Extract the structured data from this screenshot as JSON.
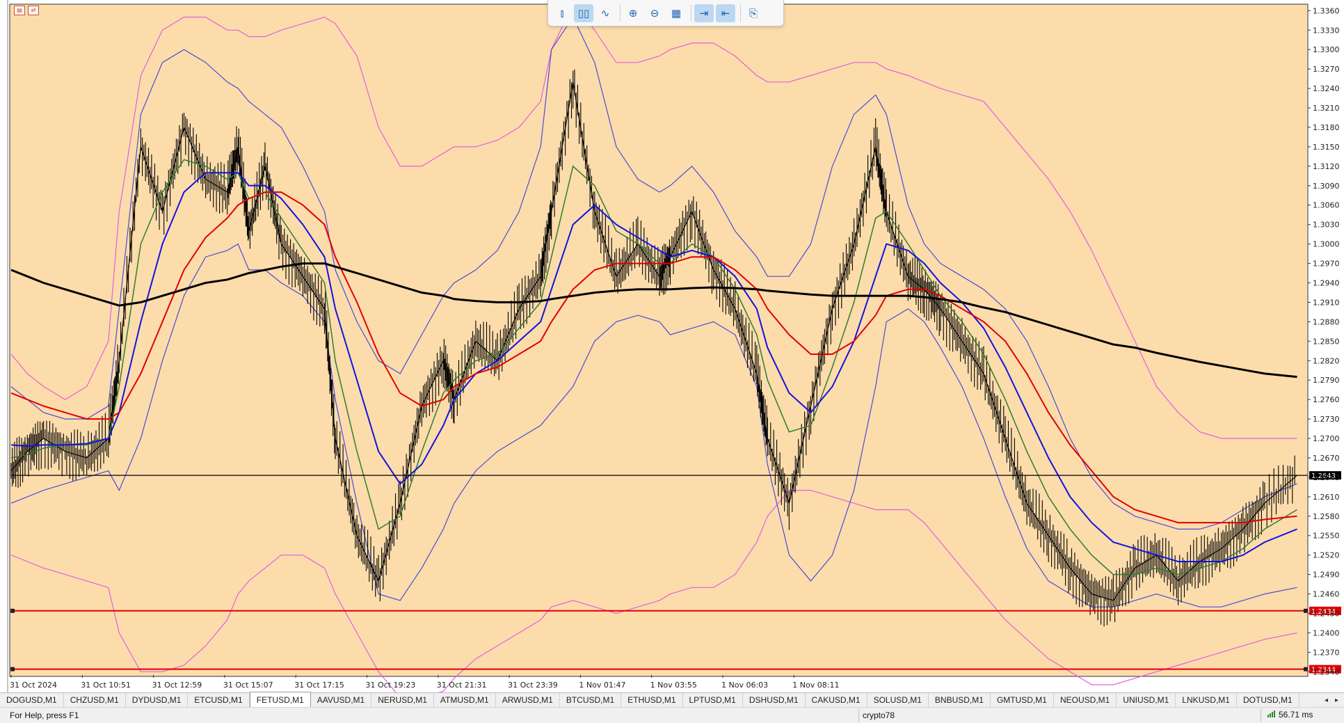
{
  "toolbar": {
    "buttons": [
      {
        "name": "bar-chart-icon",
        "glyph": "⫾",
        "active": false
      },
      {
        "name": "candlestick-chart-icon",
        "glyph": "▯▯",
        "active": true
      },
      {
        "name": "line-chart-icon",
        "glyph": "∿",
        "active": false
      },
      {
        "name": "zoom-in-icon",
        "glyph": "⊕",
        "active": false
      },
      {
        "name": "zoom-out-icon",
        "glyph": "⊖",
        "active": false
      },
      {
        "name": "grid-icon",
        "glyph": "▦",
        "active": false
      },
      {
        "name": "auto-scroll-icon",
        "glyph": "⇥",
        "active": true
      },
      {
        "name": "chart-shift-icon",
        "glyph": "⇤",
        "active": true
      },
      {
        "name": "screenshot-icon",
        "glyph": "⎘",
        "active": false
      }
    ]
  },
  "chart": {
    "background": "#fcdcab",
    "symbol_tab_active": "FETUSD,M1",
    "current_price": "1.2643",
    "levels": [
      {
        "value": "1.2434",
        "color": "#e00000"
      },
      {
        "value": "1.2344",
        "color": "#e00000"
      }
    ],
    "colors": {
      "candles": "#000000",
      "ma_fast": "#2f7d2f",
      "ma_mid": "#1212e0",
      "ma_slow": "#e00000",
      "ma_long": "#000000",
      "bb_inner": "#4a4ad8",
      "bb_outer": "#e060e0"
    }
  },
  "chart_data": {
    "type": "line",
    "title": "",
    "symbol": "FETUSD,M1",
    "y_ticks": [
      "1.3360",
      "1.3330",
      "1.3300",
      "1.3270",
      "1.3240",
      "1.3210",
      "1.3180",
      "1.3150",
      "1.3120",
      "1.3090",
      "1.3060",
      "1.3030",
      "1.3000",
      "1.2970",
      "1.2940",
      "1.2910",
      "1.2880",
      "1.2850",
      "1.2820",
      "1.2790",
      "1.2760",
      "1.2730",
      "1.2700",
      "1.2670",
      "1.2640",
      "1.2610",
      "1.2580",
      "1.2550",
      "1.2520",
      "1.2490",
      "1.2460",
      "1.2430",
      "1.2400",
      "1.2370",
      "1.2340"
    ],
    "x_ticks": [
      "31 Oct 2024",
      "31 Oct 10:51",
      "31 Oct 12:59",
      "31 Oct 15:07",
      "31 Oct 17:15",
      "31 Oct 19:23",
      "31 Oct 21:31",
      "31 Oct 23:39",
      "1 Nov 01:47",
      "1 Nov 03:55",
      "1 Nov 06:03",
      "1 Nov 08:11"
    ],
    "ylim": [
      1.2335,
      1.337
    ],
    "price_series": {
      "name": "",
      "x": [
        0,
        0.15,
        0.3,
        0.5,
        0.7,
        0.9,
        1.0,
        1.2,
        1.4,
        1.6,
        1.8,
        2.0,
        2.1,
        2.2,
        2.35,
        2.5,
        2.7,
        2.9,
        3.0,
        3.2,
        3.4,
        3.6,
        3.8,
        4.0,
        4.1,
        4.3,
        4.5,
        4.7,
        4.9,
        5.0,
        5.2,
        5.4,
        5.6,
        5.8,
        6.0,
        6.1,
        6.3,
        6.5,
        6.7,
        6.9,
        7.0,
        7.2,
        7.4,
        7.6,
        7.8,
        8.0,
        8.1,
        8.3,
        8.45,
        8.6,
        8.8,
        9.0,
        9.2,
        9.4,
        9.6,
        9.8,
        10.0,
        10.2,
        10.4,
        10.6,
        10.8,
        11.0,
        11.2,
        11.4,
        11.6,
        11.9
      ],
      "values": [
        1.265,
        1.268,
        1.27,
        1.268,
        1.267,
        1.27,
        1.282,
        1.315,
        1.305,
        1.318,
        1.31,
        1.308,
        1.315,
        1.302,
        1.312,
        1.3,
        1.295,
        1.29,
        1.27,
        1.255,
        1.248,
        1.26,
        1.275,
        1.282,
        1.276,
        1.285,
        1.282,
        1.29,
        1.295,
        1.305,
        1.325,
        1.305,
        1.295,
        1.3,
        1.295,
        1.298,
        1.305,
        1.296,
        1.29,
        1.28,
        1.27,
        1.26,
        1.275,
        1.29,
        1.3,
        1.315,
        1.305,
        1.295,
        1.293,
        1.29,
        1.285,
        1.28,
        1.27,
        1.26,
        1.255,
        1.25,
        1.246,
        1.245,
        1.25,
        1.252,
        1.248,
        1.251,
        1.253,
        1.256,
        1.26,
        1.2643
      ]
    },
    "series": [
      {
        "name": "",
        "role": "ma_fast",
        "values": [
          1.267,
          1.2675,
          1.2685,
          1.269,
          1.269,
          1.27,
          1.278,
          1.3,
          1.308,
          1.313,
          1.312,
          1.31,
          1.311,
          1.307,
          1.308,
          1.304,
          1.299,
          1.294,
          1.282,
          1.268,
          1.256,
          1.258,
          1.268,
          1.277,
          1.279,
          1.282,
          1.283,
          1.287,
          1.291,
          1.298,
          1.312,
          1.309,
          1.302,
          1.3,
          1.297,
          1.297,
          1.3,
          1.298,
          1.293,
          1.286,
          1.279,
          1.271,
          1.272,
          1.281,
          1.291,
          1.304,
          1.305,
          1.3,
          1.296,
          1.292,
          1.288,
          1.283,
          1.276,
          1.268,
          1.261,
          1.256,
          1.252,
          1.249,
          1.249,
          1.25,
          1.249,
          1.25,
          1.251,
          1.253,
          1.256,
          1.259
        ]
      },
      {
        "name": "",
        "role": "ma_mid",
        "values": [
          1.269,
          1.2688,
          1.269,
          1.269,
          1.2692,
          1.27,
          1.274,
          1.288,
          1.3,
          1.308,
          1.311,
          1.311,
          1.311,
          1.309,
          1.309,
          1.307,
          1.303,
          1.298,
          1.29,
          1.279,
          1.268,
          1.263,
          1.266,
          1.272,
          1.276,
          1.28,
          1.282,
          1.285,
          1.288,
          1.293,
          1.303,
          1.306,
          1.303,
          1.301,
          1.299,
          1.298,
          1.299,
          1.298,
          1.295,
          1.29,
          1.284,
          1.277,
          1.274,
          1.278,
          1.285,
          1.295,
          1.3,
          1.299,
          1.297,
          1.294,
          1.291,
          1.287,
          1.281,
          1.274,
          1.267,
          1.261,
          1.257,
          1.254,
          1.253,
          1.252,
          1.251,
          1.251,
          1.251,
          1.252,
          1.254,
          1.256
        ]
      },
      {
        "name": "",
        "role": "ma_slow",
        "values": [
          1.277,
          1.276,
          1.275,
          1.274,
          1.273,
          1.273,
          1.274,
          1.28,
          1.288,
          1.296,
          1.301,
          1.304,
          1.306,
          1.307,
          1.308,
          1.308,
          1.306,
          1.303,
          1.298,
          1.291,
          1.283,
          1.277,
          1.275,
          1.276,
          1.278,
          1.28,
          1.281,
          1.283,
          1.285,
          1.288,
          1.293,
          1.296,
          1.297,
          1.297,
          1.297,
          1.297,
          1.298,
          1.298,
          1.296,
          1.293,
          1.29,
          1.286,
          1.283,
          1.283,
          1.285,
          1.289,
          1.292,
          1.293,
          1.293,
          1.292,
          1.29,
          1.288,
          1.285,
          1.28,
          1.274,
          1.269,
          1.265,
          1.261,
          1.259,
          1.258,
          1.257,
          1.257,
          1.257,
          1.257,
          1.2575,
          1.258
        ]
      },
      {
        "name": "",
        "role": "ma_long",
        "values": [
          1.296,
          1.295,
          1.294,
          1.293,
          1.292,
          1.291,
          1.2905,
          1.291,
          1.292,
          1.293,
          1.294,
          1.2945,
          1.295,
          1.2955,
          1.296,
          1.2965,
          1.297,
          1.297,
          1.2965,
          1.2955,
          1.2945,
          1.2935,
          1.2925,
          1.292,
          1.2915,
          1.2912,
          1.291,
          1.291,
          1.2912,
          1.2915,
          1.292,
          1.2925,
          1.2928,
          1.293,
          1.293,
          1.293,
          1.2932,
          1.2933,
          1.2932,
          1.293,
          1.2928,
          1.2925,
          1.2922,
          1.292,
          1.292,
          1.292,
          1.292,
          1.292,
          1.2918,
          1.2915,
          1.291,
          1.2902,
          1.2895,
          1.2885,
          1.2875,
          1.2865,
          1.2855,
          1.2845,
          1.284,
          1.2832,
          1.2825,
          1.2818,
          1.2812,
          1.2806,
          1.28,
          1.2795
        ]
      },
      {
        "name": "",
        "role": "bb_inner_upper",
        "values": [
          1.278,
          1.276,
          1.274,
          1.273,
          1.273,
          1.275,
          1.29,
          1.32,
          1.328,
          1.33,
          1.328,
          1.325,
          1.324,
          1.322,
          1.32,
          1.318,
          1.312,
          1.305,
          1.296,
          1.288,
          1.282,
          1.28,
          1.286,
          1.292,
          1.294,
          1.296,
          1.299,
          1.305,
          1.315,
          1.33,
          1.335,
          1.328,
          1.315,
          1.31,
          1.308,
          1.309,
          1.312,
          1.308,
          1.302,
          1.298,
          1.295,
          1.295,
          1.3,
          1.312,
          1.32,
          1.323,
          1.32,
          1.306,
          1.3,
          1.297,
          1.295,
          1.293,
          1.29,
          1.285,
          1.278,
          1.27,
          1.264,
          1.26,
          1.258,
          1.257,
          1.256,
          1.256,
          1.257,
          1.259,
          1.261,
          1.263
        ]
      },
      {
        "name": "",
        "role": "bb_inner_lower",
        "values": [
          1.26,
          1.261,
          1.262,
          1.263,
          1.264,
          1.265,
          1.262,
          1.27,
          1.282,
          1.292,
          1.298,
          1.299,
          1.3,
          1.296,
          1.296,
          1.294,
          1.292,
          1.288,
          1.276,
          1.26,
          1.246,
          1.245,
          1.25,
          1.256,
          1.26,
          1.265,
          1.268,
          1.27,
          1.272,
          1.274,
          1.278,
          1.285,
          1.288,
          1.289,
          1.288,
          1.286,
          1.287,
          1.288,
          1.286,
          1.278,
          1.266,
          1.252,
          1.248,
          1.252,
          1.262,
          1.278,
          1.288,
          1.29,
          1.288,
          1.284,
          1.278,
          1.27,
          1.261,
          1.253,
          1.248,
          1.246,
          1.244,
          1.244,
          1.245,
          1.246,
          1.245,
          1.244,
          1.244,
          1.245,
          1.246,
          1.247
        ]
      },
      {
        "name": "",
        "role": "bb_outer_upper",
        "values": [
          1.283,
          1.28,
          1.278,
          1.276,
          1.278,
          1.285,
          1.305,
          1.326,
          1.333,
          1.335,
          1.335,
          1.333,
          1.333,
          1.332,
          1.332,
          1.333,
          1.334,
          1.335,
          1.334,
          1.329,
          1.318,
          1.312,
          1.312,
          1.314,
          1.315,
          1.315,
          1.316,
          1.318,
          1.322,
          1.33,
          1.337,
          1.333,
          1.328,
          1.328,
          1.329,
          1.33,
          1.331,
          1.331,
          1.329,
          1.326,
          1.325,
          1.325,
          1.326,
          1.327,
          1.328,
          1.328,
          1.327,
          1.326,
          1.325,
          1.324,
          1.323,
          1.322,
          1.318,
          1.314,
          1.31,
          1.305,
          1.299,
          1.292,
          1.285,
          1.278,
          1.274,
          1.271,
          1.27,
          1.27,
          1.27,
          1.27
        ]
      },
      {
        "name": "",
        "role": "bb_outer_lower",
        "values": [
          1.252,
          1.251,
          1.25,
          1.249,
          1.248,
          1.247,
          1.24,
          1.234,
          1.234,
          1.235,
          1.238,
          1.242,
          1.246,
          1.248,
          1.25,
          1.252,
          1.252,
          1.25,
          1.246,
          1.24,
          1.234,
          1.23,
          1.23,
          1.231,
          1.233,
          1.236,
          1.238,
          1.24,
          1.242,
          1.244,
          1.245,
          1.244,
          1.243,
          1.244,
          1.245,
          1.246,
          1.247,
          1.247,
          1.249,
          1.254,
          1.258,
          1.262,
          1.262,
          1.261,
          1.26,
          1.259,
          1.259,
          1.259,
          1.257,
          1.254,
          1.25,
          1.246,
          1.242,
          1.239,
          1.236,
          1.234,
          1.232,
          1.232,
          1.233,
          1.234,
          1.235,
          1.236,
          1.237,
          1.238,
          1.239,
          1.24
        ]
      }
    ],
    "hlines": [
      {
        "value": 1.2643,
        "label": "1.2643",
        "color": "#000000"
      },
      {
        "value": 1.2434,
        "label": "1.2434",
        "color": "#e00000"
      },
      {
        "value": 1.2344,
        "label": "1.2344",
        "color": "#e00000"
      }
    ],
    "grid": false
  },
  "tabs": [
    "DOGUSD,M1",
    "CHZUSD,M1",
    "DYDUSD,M1",
    "ETCUSD,M1",
    "FETUSD,M1",
    "AAVUSD,M1",
    "NERUSD,M1",
    "ATMUSD,M1",
    "ARWUSD,M1",
    "BTCUSD,M1",
    "ETHUSD,M1",
    "LPTUSD,M1",
    "DSHUSD,M1",
    "CAKUSD,M1",
    "SOLUSD,M1",
    "BNBUSD,M1",
    "GMTUSD,M1",
    "NEOUSD,M1",
    "UNIUSD,M1",
    "LNKUSD,M1",
    "DOTUSD,M1"
  ],
  "tab_nav": {
    "prev": "◂",
    "next": "▸"
  },
  "status": {
    "help": "For Help, press F1",
    "profile": "crypto78",
    "ping": "56.71 ms"
  }
}
